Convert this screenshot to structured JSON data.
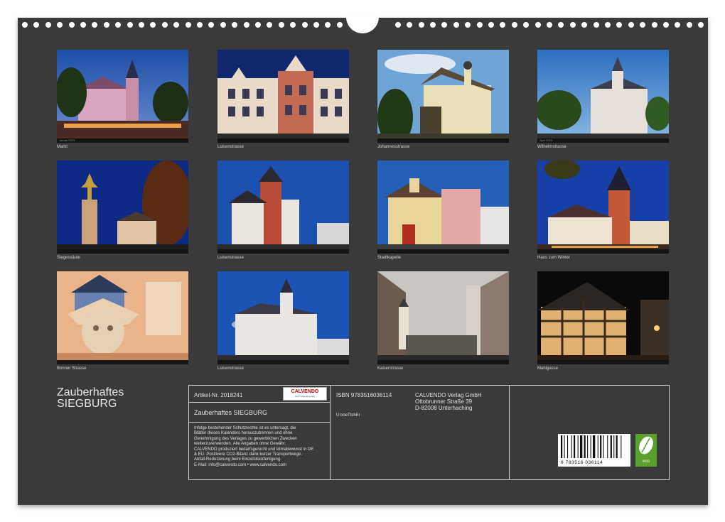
{
  "photos": [
    {
      "caption": "Markt",
      "strip": "Januar 2019"
    },
    {
      "caption": "Luisenstrasse",
      "strip": ""
    },
    {
      "caption": "Johannesstrasse",
      "strip": ""
    },
    {
      "caption": "Wilhelmstrasse",
      "strip": "April 2019"
    },
    {
      "caption": "Siegessäule",
      "strip": ""
    },
    {
      "caption": "Luisenstrasse",
      "strip": ""
    },
    {
      "caption": "Stadtkapelle",
      "strip": ""
    },
    {
      "caption": "Haus zum Winter",
      "strip": ""
    },
    {
      "caption": "Bonner Strasse",
      "strip": ""
    },
    {
      "caption": "Luisenstrasse",
      "strip": ""
    },
    {
      "caption": "Kaiserstrasse",
      "strip": ""
    },
    {
      "caption": "Mahlgasse",
      "strip": ""
    }
  ],
  "title": {
    "line1": "Zauberhaftes",
    "line2": "SIEGBURG"
  },
  "info": {
    "article": "Artikel-Nr. 2018241",
    "logo": "CALVENDO",
    "logo_sub": "Mein Kalenderverlag",
    "product": "Zauberhaftes SIEGBURG",
    "legal": [
      "Infolge bestehender Schutzrechte ist es untersagt, die",
      "Blätter dieses Kalenders herauszutrennen und ohne",
      "Genehmigung des Verlages zu gewerblichen Zwecken",
      "weiterzuverwenden. Alle Angaben ohne Gewähr.",
      "CALVENDO produziert bedarfsgerecht und klimabewusst in DE",
      "& EU. Positivere CO2-Bilanz dank kurzer Transportwege.",
      "Abfall-Reduzierung beim Einzelstückfertigung.",
      "E-Mail: info@calvendo.com • www.calvendo.com"
    ],
    "isbn": "ISBN 9783516036114",
    "author": "U boeTtchEr",
    "publisher": [
      "CALVENDO Verlag GmbH",
      "Ottobrunner Straße 39",
      "D-82008 Unterhaching"
    ],
    "barcode_number": "9 783516 036114",
    "eco_label": "eco"
  }
}
